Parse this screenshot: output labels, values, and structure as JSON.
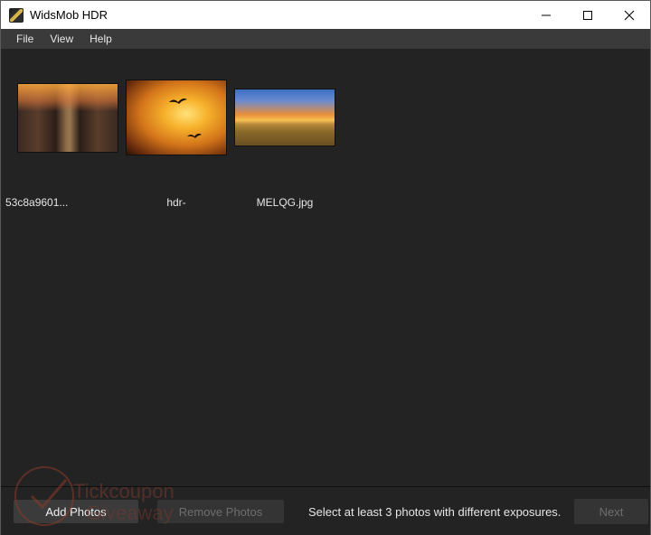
{
  "window": {
    "title": "WidsMob HDR",
    "controls": [
      "minimize-icon",
      "maximize-icon",
      "close-icon"
    ]
  },
  "menu": {
    "items": [
      {
        "label": "File"
      },
      {
        "label": "View"
      },
      {
        "label": "Help"
      }
    ]
  },
  "photos": [
    {
      "label": "53c8a9601...",
      "icon": "street-photo"
    },
    {
      "label": "hdr-",
      "icon": "bird-sunset-photo"
    },
    {
      "label": "MELQG.jpg",
      "icon": "field-sunset-photo"
    }
  ],
  "footer": {
    "add_label": "Add Photos",
    "remove_label": "Remove Photos",
    "status": "Select at least 3 photos with different exposures.",
    "next_label": "Next"
  },
  "watermark": {
    "line1": "Tickcoupon",
    "line2": "Giveaway"
  },
  "colors": {
    "background": "#232323",
    "menubar": "#3a3a3a",
    "button": "#3b3b3b",
    "text": "#e6e6e6",
    "disabled_text": "#6e6e6e"
  }
}
